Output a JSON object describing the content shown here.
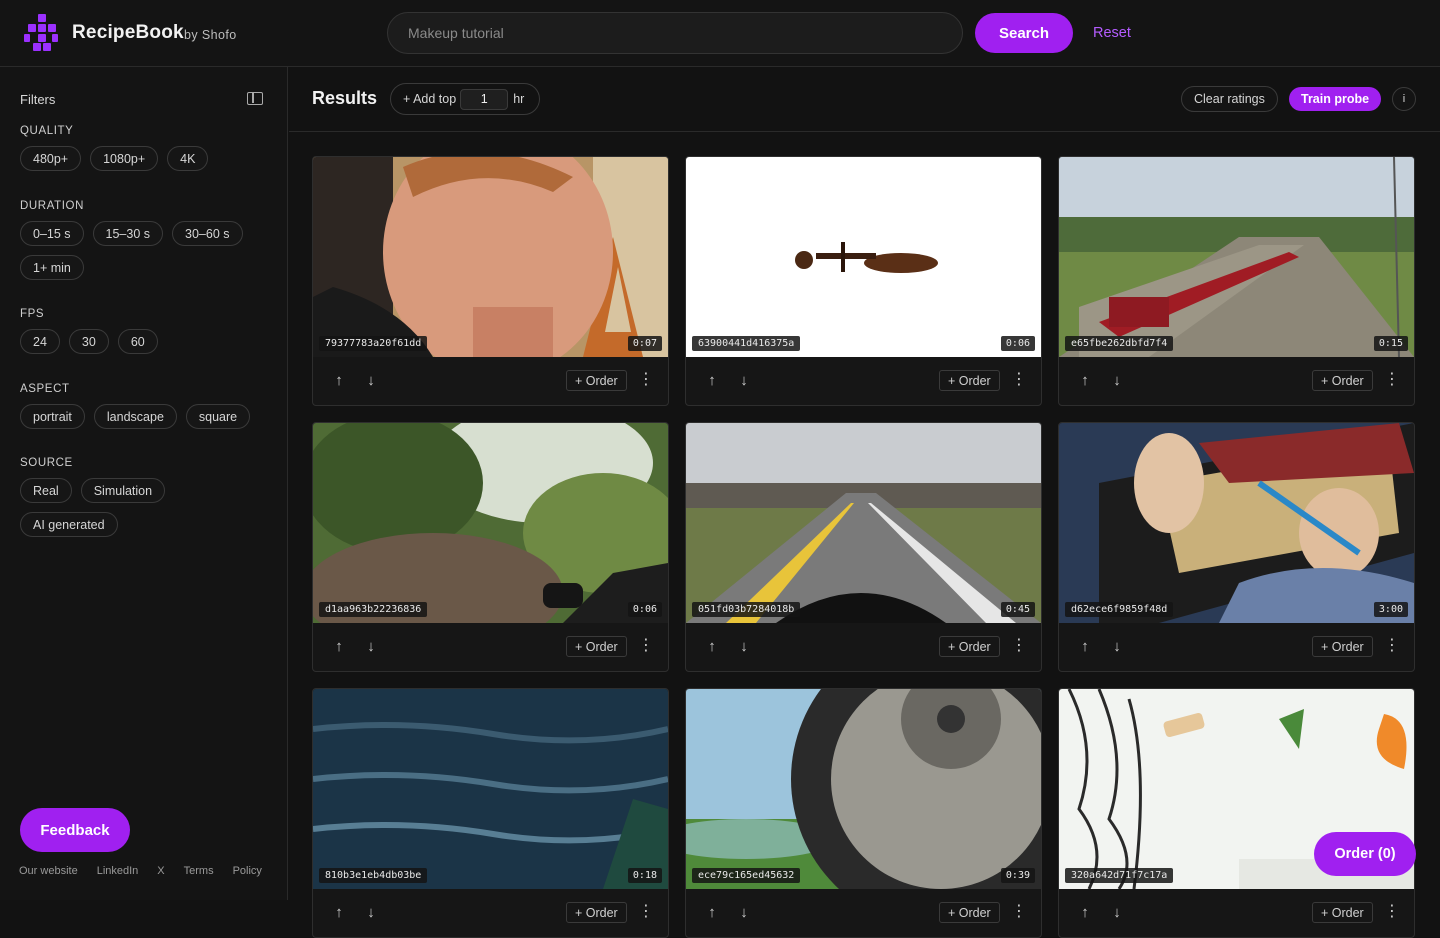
{
  "header": {
    "brand": "RecipeBook",
    "byline": "by Shofo",
    "search_placeholder": "Makeup tutorial",
    "search_label": "Search",
    "reset_label": "Reset"
  },
  "sidebar": {
    "title": "Filters",
    "groups": [
      {
        "label": "QUALITY",
        "options": [
          "480p+",
          "1080p+",
          "4K"
        ]
      },
      {
        "label": "DURATION",
        "options": [
          "0–15 s",
          "15–30 s",
          "30–60 s",
          "1+ min"
        ]
      },
      {
        "label": "FPS",
        "options": [
          "24",
          "30",
          "60"
        ]
      },
      {
        "label": "ASPECT",
        "options": [
          "portrait",
          "landscape",
          "square"
        ]
      },
      {
        "label": "SOURCE",
        "options": [
          "Real",
          "Simulation",
          "AI generated"
        ]
      }
    ],
    "feedback_label": "Feedback",
    "footer_links": [
      "Our website",
      "LinkedIn",
      "X",
      "Terms",
      "Policy"
    ]
  },
  "results": {
    "title": "Results",
    "add_top_label": "+ Add top",
    "add_top_value": "1",
    "add_top_unit": "hr",
    "clear_label": "Clear ratings",
    "train_label": "Train probe",
    "info_label": "i",
    "order_float_label": "Order (0)"
  },
  "cards": [
    {
      "id": "79377783a20f61dd",
      "duration": "0:07",
      "order_label": "+ Order"
    },
    {
      "id": "63900441d416375a",
      "duration": "0:06",
      "order_label": "+ Order"
    },
    {
      "id": "e65fbe262dbfd7f4",
      "duration": "0:15",
      "order_label": "+ Order"
    },
    {
      "id": "d1aa963b22236836",
      "duration": "0:06",
      "order_label": "+ Order"
    },
    {
      "id": "051fd03b7284018b",
      "duration": "0:45",
      "order_label": "+ Order"
    },
    {
      "id": "d62ece6f9859f48d",
      "duration": "3:00",
      "order_label": "+ Order"
    },
    {
      "id": "810b3e1eb4db03be",
      "duration": "0:18",
      "order_label": "+ Order"
    },
    {
      "id": "ece79c165ed45632",
      "duration": "0:39",
      "order_label": "+ Order"
    },
    {
      "id": "320a642d71f7c17a",
      "duration": "",
      "order_label": "+ Order"
    }
  ],
  "colors": {
    "accent": "#a020f0",
    "background": "#121212"
  }
}
